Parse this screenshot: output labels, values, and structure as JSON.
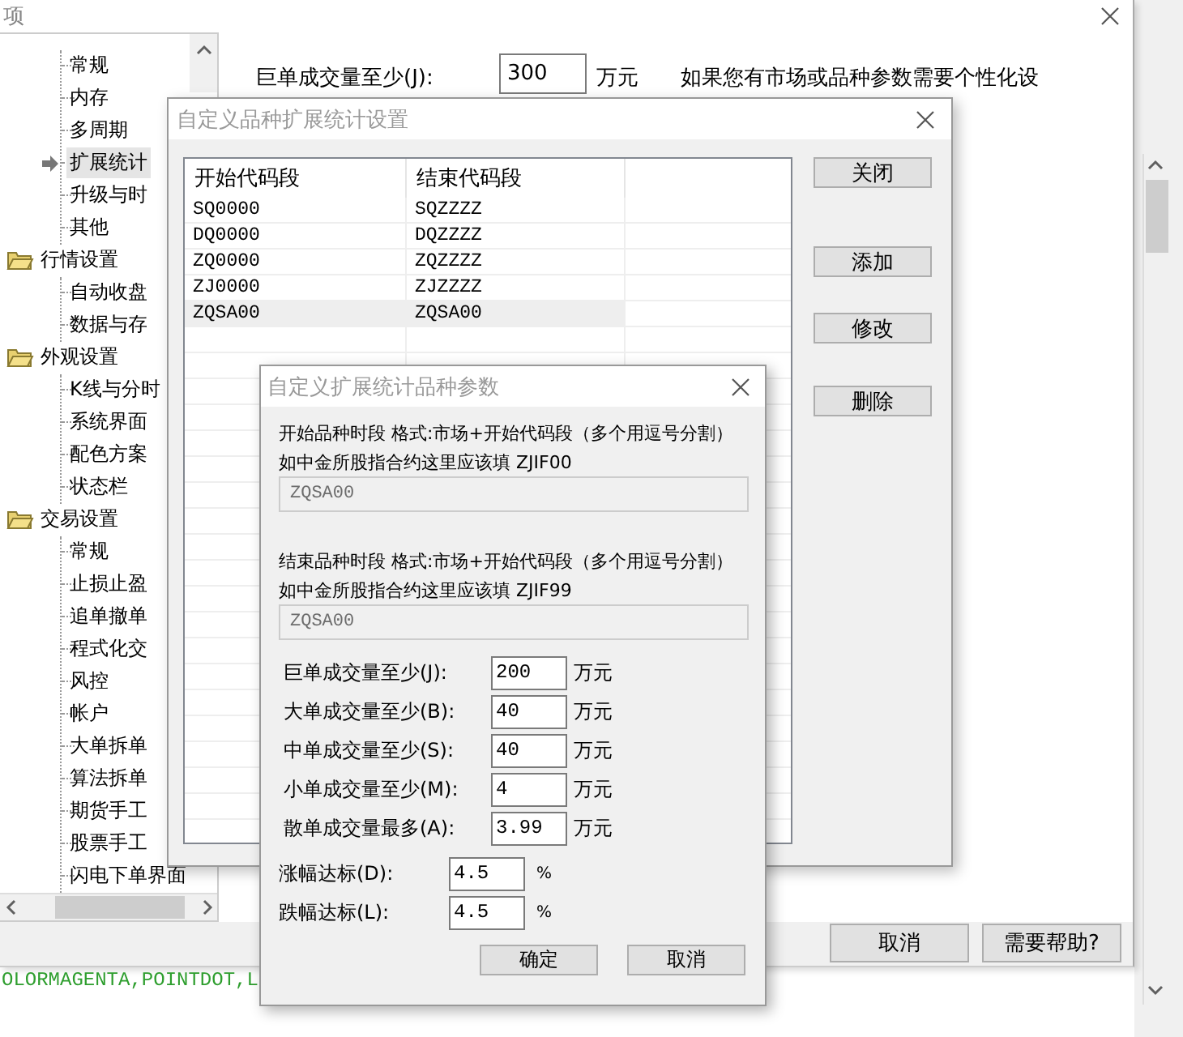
{
  "main_window": {
    "title": "项",
    "tree": [
      {
        "children": [
          {
            "label": "常规",
            "selected": false
          },
          {
            "label": "内存",
            "selected": false
          },
          {
            "label": "多周期",
            "selected": false
          },
          {
            "label": "扩展统计",
            "selected": true
          },
          {
            "label": "升级与时",
            "selected": false
          },
          {
            "label": "其他",
            "selected": false
          }
        ]
      },
      {
        "label": "行情设置",
        "children": [
          {
            "label": "自动收盘",
            "selected": false
          },
          {
            "label": "数据与存",
            "selected": false
          }
        ]
      },
      {
        "label": "外观设置",
        "children": [
          {
            "label": "K线与分时",
            "selected": false
          },
          {
            "label": "系统界面",
            "selected": false
          },
          {
            "label": "配色方案",
            "selected": false
          },
          {
            "label": "状态栏",
            "selected": false
          }
        ]
      },
      {
        "label": "交易设置",
        "children": [
          {
            "label": "常规",
            "selected": false
          },
          {
            "label": "止损止盈",
            "selected": false
          },
          {
            "label": "追单撤单",
            "selected": false
          },
          {
            "label": "程式化交",
            "selected": false
          },
          {
            "label": "风控",
            "selected": false
          },
          {
            "label": "帐户",
            "selected": false
          },
          {
            "label": "大单拆单",
            "selected": false
          },
          {
            "label": "算法拆单",
            "selected": false
          },
          {
            "label": "期货手工",
            "selected": false
          },
          {
            "label": "股票手工",
            "selected": false
          },
          {
            "label": "闪电下单界面",
            "selected": false
          }
        ]
      }
    ],
    "field": {
      "label": "巨单成交量至少(J):",
      "value": "300",
      "unit": "万元"
    },
    "note": "如果您有市场或品种参数需要个性化设",
    "buttons": [
      "取消",
      "需要帮助?"
    ],
    "console_text": "OLORMAGENTA,POINTDOT,L"
  },
  "list_dialog": {
    "title": "自定义品种扩展统计设置",
    "columns": [
      "开始代码段",
      "结束代码段"
    ],
    "rows": [
      {
        "cells": [
          "SQ0000",
          "SQZZZZ"
        ],
        "selected": false
      },
      {
        "cells": [
          "DQ0000",
          "DQZZZZ"
        ],
        "selected": false
      },
      {
        "cells": [
          "ZQ0000",
          "ZQZZZZ"
        ],
        "selected": false
      },
      {
        "cells": [
          "ZJ0000",
          "ZJZZZZ"
        ],
        "selected": false
      },
      {
        "cells": [
          "ZQSA00",
          "ZQSA00"
        ],
        "selected": true
      }
    ],
    "buttons": [
      "关闭",
      "添加",
      "修改",
      "删除"
    ]
  },
  "param_dialog": {
    "title": "自定义扩展统计品种参数",
    "ranges": [
      {
        "hint": "开始品种时段 格式:市场+开始代码段（多个用逗号分割）",
        "example": "如中金所股指合约这里应该填 ZJIF00",
        "value": "ZQSA00",
        "disabled": true
      },
      {
        "hint": "结束品种时段 格式:市场+开始代码段（多个用逗号分割）",
        "example": "如中金所股指合约这里应该填 ZJIF99",
        "value": "ZQSA00",
        "disabled": true
      }
    ],
    "params": [
      {
        "kind": "amount",
        "label": "巨单成交量至少(J):",
        "value": "200",
        "unit": "万元"
      },
      {
        "kind": "amount",
        "label": "大单成交量至少(B):",
        "value": "40",
        "unit": "万元"
      },
      {
        "kind": "amount",
        "label": "中单成交量至少(S):",
        "value": "40",
        "unit": "万元"
      },
      {
        "kind": "amount",
        "label": "小单成交量至少(M):",
        "value": "4",
        "unit": "万元"
      },
      {
        "kind": "amount",
        "label": "散单成交量最多(A):",
        "value": "3.99",
        "unit": "万元"
      },
      {
        "kind": "percent",
        "label": "涨幅达标(D):",
        "value": "4.5",
        "unit": "%"
      },
      {
        "kind": "percent",
        "label": "跌幅达标(L):",
        "value": "4.5",
        "unit": "%"
      }
    ],
    "buttons": [
      "确定",
      "取消"
    ]
  }
}
